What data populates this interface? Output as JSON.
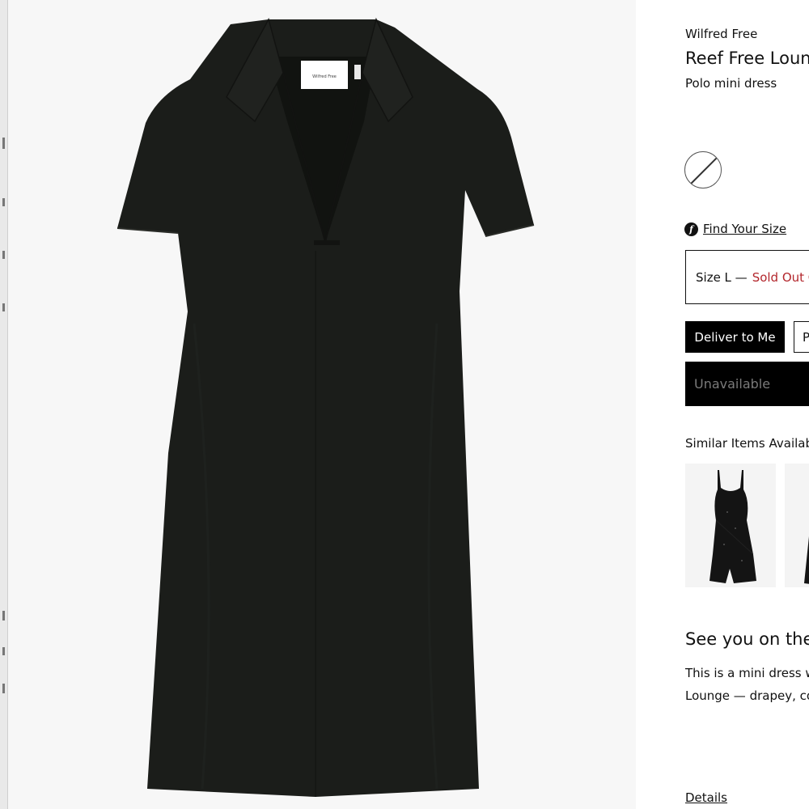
{
  "product": {
    "brand": "Wilfred Free",
    "title": "Reef Free Loun",
    "subtitle": "Polo mini dress",
    "label_tag": "Wilfred Free",
    "swatch_state": "unavailable-colour"
  },
  "size_guide": {
    "icon": "fit-finder-icon",
    "icon_glyph": "f",
    "link_label": "Find Your Size"
  },
  "size_selector": {
    "size_label": "Size L —",
    "status": "Sold Out C",
    "status_color": "#b3262c"
  },
  "fulfillment": {
    "deliver_label": "Deliver to Me",
    "pickup_label": "P"
  },
  "add_to_bag": {
    "label": "Unavailable"
  },
  "similar": {
    "heading": "Similar Items Availab"
  },
  "story": {
    "tagline": "See you on the",
    "line1": "This is a mini dress w",
    "line2": "Lounge — drapey, co"
  },
  "details": {
    "link_label": "Details"
  },
  "colors": {
    "primary": "#000000",
    "dress": "#1b1d1a",
    "sold_out": "#b3262c",
    "image_bg": "#f7f7f7"
  }
}
